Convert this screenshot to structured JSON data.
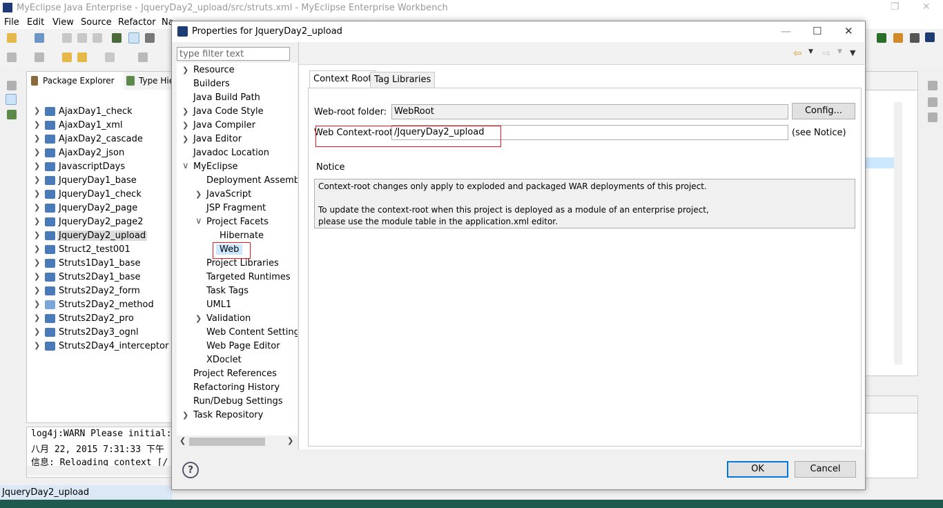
{
  "window": {
    "title": "MyEclipse Java Enterprise - JqueryDay2_upload/src/struts.xml - MyEclipse Enterprise Workbench"
  },
  "menu": [
    "File",
    "Edit",
    "View",
    "Source",
    "Refactor",
    "Na"
  ],
  "explorer": {
    "tabs": [
      "Package Explorer",
      "Type Hie"
    ],
    "projects": [
      {
        "label": "AjaxDay1_check"
      },
      {
        "label": "AjaxDay1_xml"
      },
      {
        "label": "AjaxDay2_cascade"
      },
      {
        "label": "AjaxDay2_json"
      },
      {
        "label": "JavascriptDays"
      },
      {
        "label": "JqueryDay1_base"
      },
      {
        "label": "JqueryDay1_check"
      },
      {
        "label": "JqueryDay2_page"
      },
      {
        "label": "JqueryDay2_page2"
      },
      {
        "label": "JqueryDay2_upload"
      },
      {
        "label": "Struct2_test001"
      },
      {
        "label": "Struts1Day1_base"
      },
      {
        "label": "Struts2Day1_base"
      },
      {
        "label": "Struts2Day2_form"
      },
      {
        "label": "Struts2Day2_method"
      },
      {
        "label": "Struts2Day2_pro"
      },
      {
        "label": "Struts2Day3_ognl"
      },
      {
        "label": "Struts2Day4_interceptor"
      }
    ],
    "selected": "JqueryDay2_upload"
  },
  "console": {
    "lines": [
      "log4j:WARN Please initial:",
      "八月 22, 2015 7:31:33 下午",
      "信息: Reloading context [/"
    ]
  },
  "status": {
    "text": "JqueryDay2_upload"
  },
  "dialog": {
    "title": "Properties for JqueryDay2_upload",
    "filter_placeholder": "type filter text",
    "tree": [
      {
        "label": "Resource"
      },
      {
        "label": "Builders"
      },
      {
        "label": "Java Build Path"
      },
      {
        "label": "Java Code Style"
      },
      {
        "label": "Java Compiler"
      },
      {
        "label": "Java Editor"
      },
      {
        "label": "Javadoc Location"
      },
      {
        "label": "MyEclipse"
      },
      {
        "label": "Deployment Assembl"
      },
      {
        "label": "JavaScript"
      },
      {
        "label": "JSP Fragment"
      },
      {
        "label": "Project Facets"
      },
      {
        "label": "Hibernate"
      },
      {
        "label": "Web"
      },
      {
        "label": "Project Libraries"
      },
      {
        "label": "Targeted Runtimes"
      },
      {
        "label": "Task Tags"
      },
      {
        "label": "UML1"
      },
      {
        "label": "Validation"
      },
      {
        "label": "Web Content Settings"
      },
      {
        "label": "Web Page Editor"
      },
      {
        "label": "XDoclet"
      },
      {
        "label": "Project References"
      },
      {
        "label": "Refactoring History"
      },
      {
        "label": "Run/Debug Settings"
      },
      {
        "label": "Task Repository"
      }
    ],
    "tabs": [
      "Context Root",
      "Tag Libraries"
    ],
    "webroot_label": "Web-root folder:",
    "webroot_value": "WebRoot",
    "config_button": "Config...",
    "context_label": "Web Context-root:",
    "context_value": "/JqueryDay2_upload",
    "see_notice": "(see Notice)",
    "notice_title": "Notice",
    "notice_lines": [
      "Context-root changes only apply to exploded and packaged WAR deployments of this project.",
      "To update the context-root when this project is deployed as a module of an enterprise project,",
      "please use the module table in the application.xml editor."
    ],
    "ok": "OK",
    "cancel": "Cancel",
    "help": "?"
  },
  "colors": {
    "accent": "#0078d7",
    "highlight": "#e8171b",
    "selection": "#cce8ff"
  }
}
